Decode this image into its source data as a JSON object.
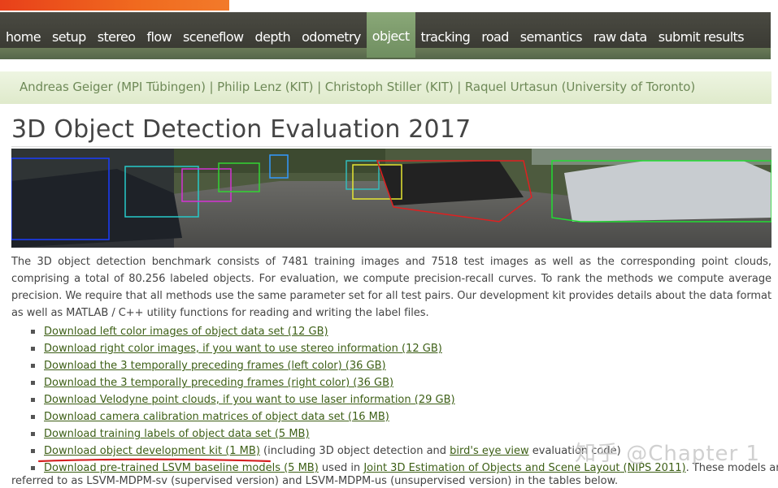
{
  "nav": {
    "items": [
      "home",
      "setup",
      "stereo",
      "flow",
      "sceneflow",
      "depth",
      "odometry",
      "object",
      "tracking",
      "road",
      "semantics",
      "raw data",
      "submit results"
    ],
    "active": "object"
  },
  "authors": "Andreas Geiger (MPI Tübingen) | Philip Lenz (KIT) | Christoph Stiller (KIT) | Raquel Urtasun (University of Toronto)",
  "page_title": "3D Object Detection Evaluation 2017",
  "description": "The 3D object detection benchmark consists of 7481 training images and 7518 test images as well as the corresponding point clouds, comprising a total of 80.256 labeled objects. For evaluation, we compute precision-recall curves. To rank the methods we compute average precision. We require that all methods use the same parameter set for all test pairs. Our development kit provides details about the data format as well as MATLAB / C++ utility functions for reading and writing the label files.",
  "downloads": {
    "left_images": "Download left color images of object data set (12 GB)",
    "right_images": "Download right color images, if you want to use stereo information (12 GB)",
    "prev_left": "Download the 3 temporally preceding frames (left color) (36 GB)",
    "prev_right": "Download the 3 temporally preceding frames (right color) (36 GB)",
    "velodyne": "Download Velodyne point clouds, if you want to use laser information (29 GB)",
    "calib": "Download camera calibration matrices of object data set (16 MB)",
    "labels": "Download training labels of object data set (5 MB)",
    "devkit": "Download object development kit (1 MB)",
    "devkit_suffix_1": " (including 3D object detection and ",
    "birdseye": "bird's eye view",
    "devkit_suffix_2": " evaluation code)",
    "lsvm": "Download pre-trained LSVM baseline models",
    "lsvm_size": " (5 MB)",
    "lsvm_mid": " used in ",
    "joint": "Joint 3D Estimation of Objects and Scene Layout",
    "nips": " (NIPS 2011)",
    "lsvm_end": ". These models are"
  },
  "tail_text": "referred to as LSVM-MDPM-sv (supervised version) and LSVM-MDPM-us (unsupervised version) in the tables below.",
  "watermark": "知乎 @Chapter 1",
  "colors": {
    "link": "#3d5f16",
    "nav_bg": "#3a3a33",
    "nav_active": "#7a9a68",
    "author_text": "#6f8a58",
    "annotation_red": "#d42020"
  }
}
